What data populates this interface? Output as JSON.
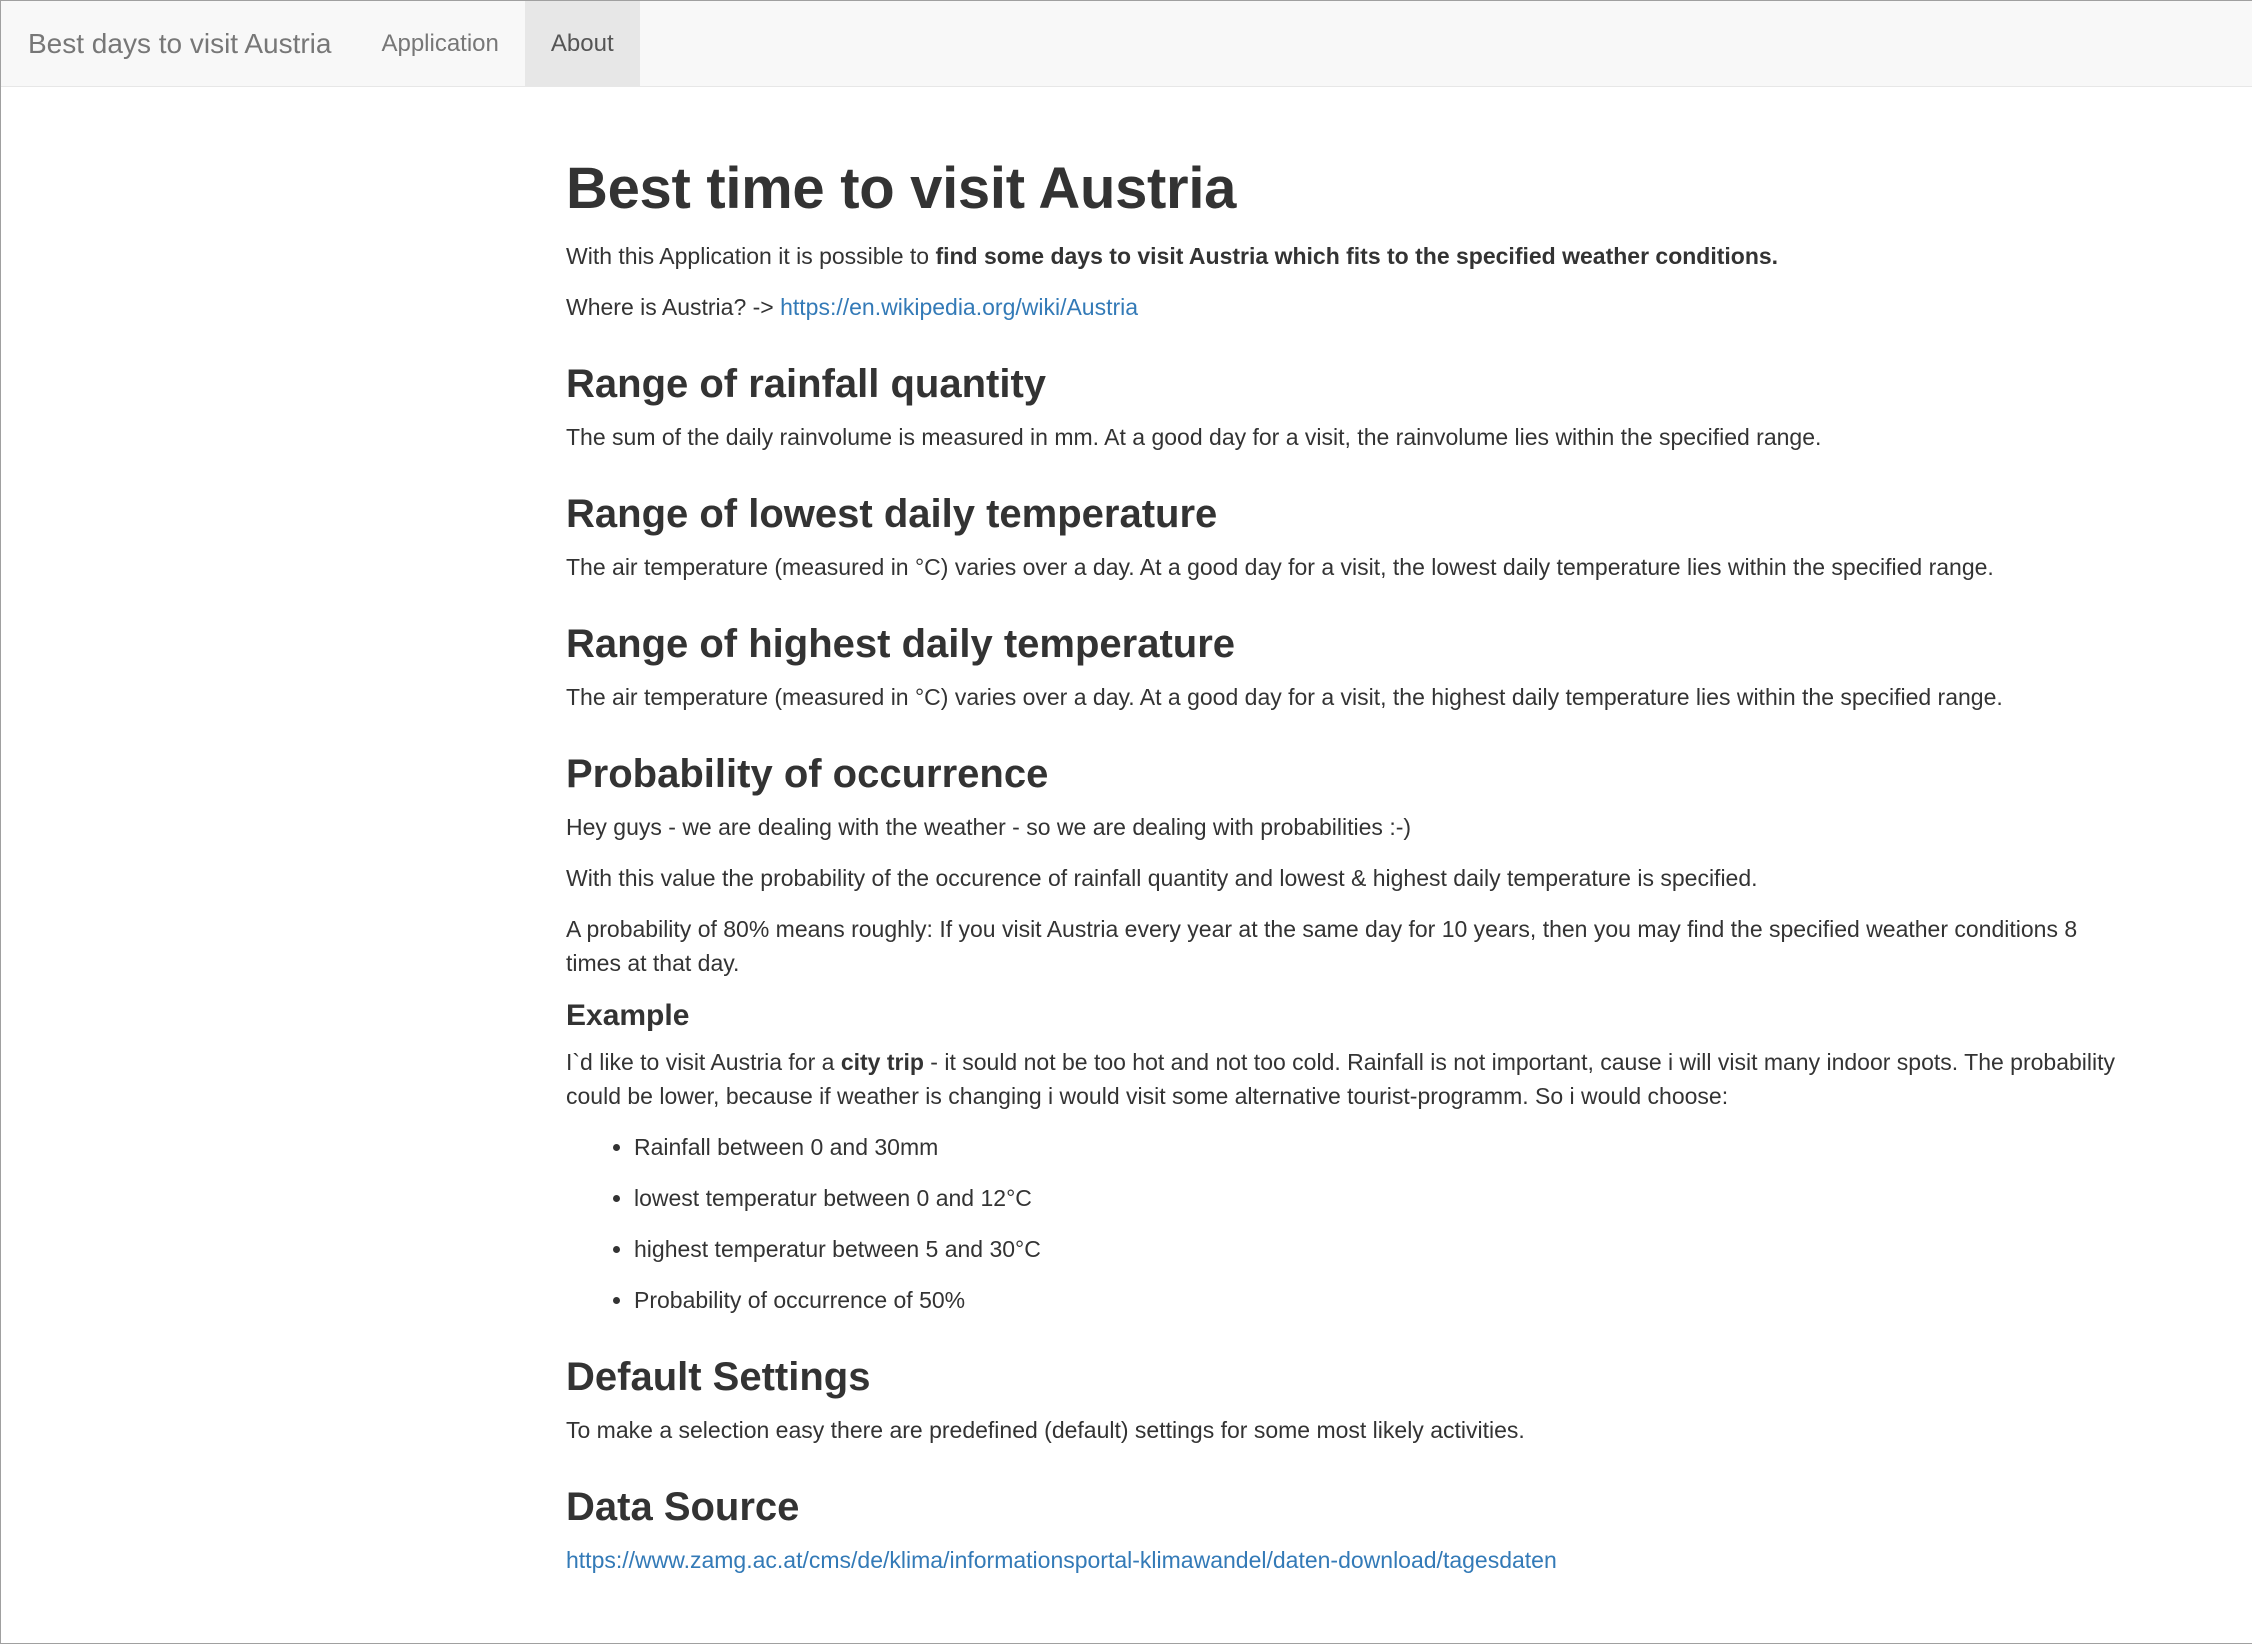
{
  "navbar": {
    "brand": "Best days to visit Austria",
    "tabs": [
      {
        "label": "Application",
        "active": false
      },
      {
        "label": "About",
        "active": true
      }
    ]
  },
  "main": {
    "title": "Best time to visit Austria",
    "intro": {
      "prefix": "With this Application it is possible to ",
      "bold": "find some days to visit Austria which fits to the specified weather conditions."
    },
    "where": {
      "prefix": "Where is Austria? -> ",
      "link": "https://en.wikipedia.org/wiki/Austria"
    },
    "rainfall": {
      "heading": "Range of rainfall quantity",
      "text": "The sum of the daily rainvolume is measured in mm. At a good day for a visit, the rainvolume lies within the specified range."
    },
    "lowest_temp": {
      "heading": "Range of lowest daily temperature",
      "text": "The air temperature (measured in °C) varies over a day. At a good day for a visit, the lowest daily temperature lies within the specified range."
    },
    "highest_temp": {
      "heading": "Range of highest daily temperature",
      "text": "The air temperature (measured in °C) varies over a day. At a good day for a visit, the highest daily temperature lies within the specified range."
    },
    "probability": {
      "heading": "Probability of occurrence",
      "p1": "Hey guys - we are dealing with the weather - so we are dealing with probabilities :-)",
      "p2": "With this value the probability of the occurence of rainfall quantity and lowest & highest daily temperature is specified.",
      "p3": "A probability of 80% means roughly: If you visit Austria every year at the same day for 10 years, then you may find the specified weather conditions 8 times at that day."
    },
    "example": {
      "heading": "Example",
      "prefix": "I`d like to visit Austria for a ",
      "bold": "city trip",
      "suffix": " - it sould not be too hot and not too cold. Rainfall is not important, cause i will visit many indoor spots. The probability could be lower, because if weather is changing i would visit some alternative tourist-programm. So i would choose:",
      "items": [
        "Rainfall between 0 and 30mm",
        "lowest temperatur between 0 and 12°C",
        "highest temperatur between 5 and 30°C",
        "Probability of occurrence of 50%"
      ]
    },
    "defaults": {
      "heading": "Default Settings",
      "text": "To make a selection easy there are predefined (default) settings for some most likely activities."
    },
    "source": {
      "heading": "Data Source",
      "link": "https://www.zamg.ac.at/cms/de/klima/informationsportal-klimawandel/daten-download/tagesdaten"
    }
  }
}
